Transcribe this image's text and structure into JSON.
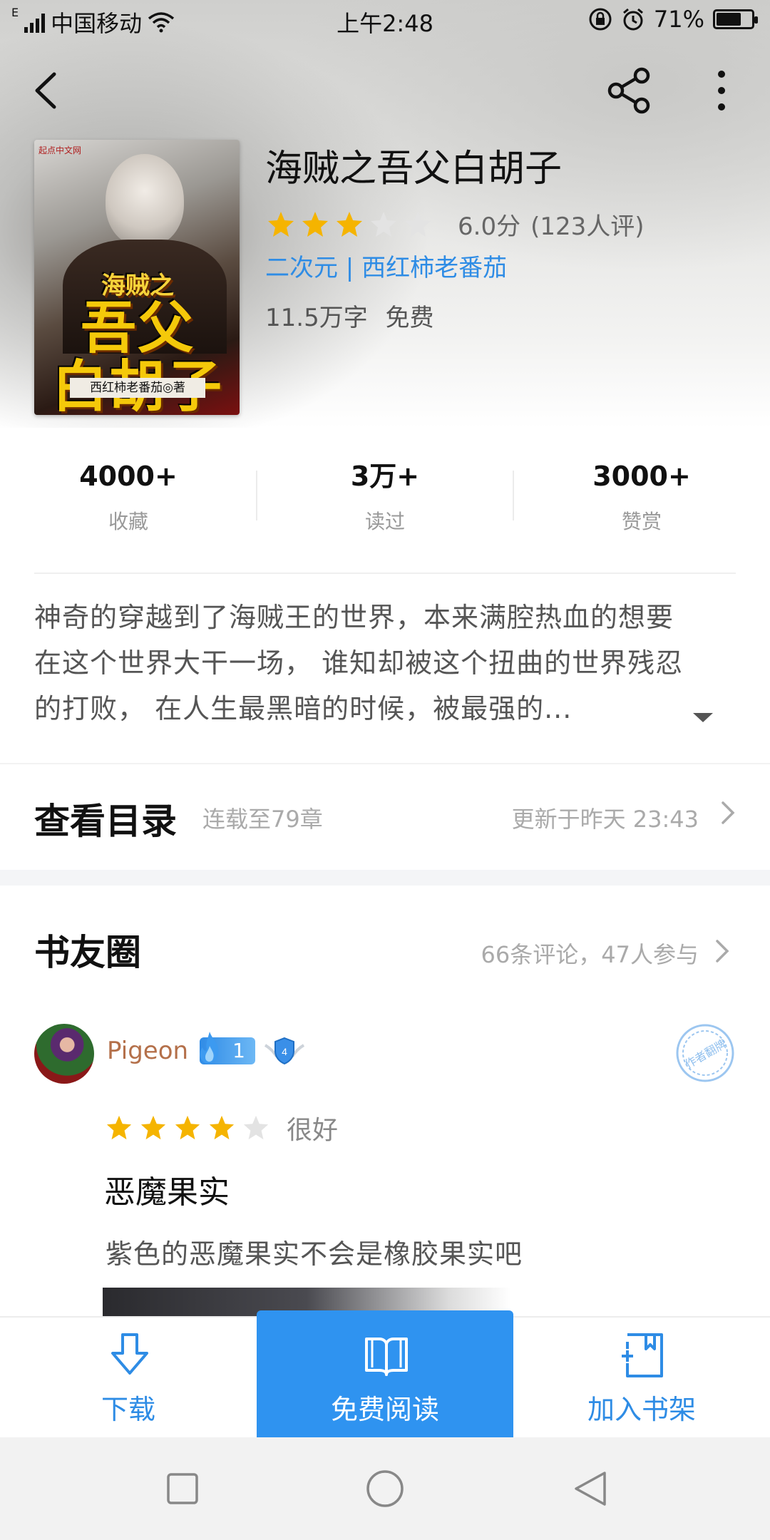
{
  "status_bar": {
    "carrier": "中国移动",
    "time": "上午2:48",
    "battery": "71%",
    "battery_level": 0.71,
    "network_small": "E"
  },
  "book": {
    "title": "海贼之吾父白胡子",
    "rating_stars": 3,
    "rating_max": 5,
    "score": "6.0分",
    "rating_count": "(123人评)",
    "tags": "二次元 | 西红柿老番茄",
    "word_count": "11.5万字",
    "price": "免费",
    "cover": {
      "publisher_mark": "起点中文网",
      "small_title": "海贼之",
      "big_title_line1": "吾父",
      "big_title_line2": "白胡子",
      "author_strip": "西红柿老番茄◎著"
    }
  },
  "stats": [
    {
      "value": "4000+",
      "label": "收藏"
    },
    {
      "value": "3万+",
      "label": "读过"
    },
    {
      "value": "3000+",
      "label": "赞赏"
    }
  ],
  "description": {
    "line1": "神奇的穿越到了海贼王的世界，本来满腔热血的想要",
    "line2": "在这个世界大干一场， 谁知却被这个扭曲的世界残忍",
    "line3": "的打败， 在人生最黑暗的时候，被最强的..."
  },
  "catalog": {
    "title": "查看目录",
    "progress": "连载至79章",
    "updated": "更新于昨天 23:43"
  },
  "circle": {
    "title": "书友圈",
    "summary": "66条评论，47人参与"
  },
  "review": {
    "username": "Pigeon",
    "fan_level": "1",
    "vip_level": "4",
    "stamp_text": "作者翻牌",
    "stars": 4,
    "rating_word": "很好",
    "title": "恶魔果实",
    "body": "紫色的恶魔果实不会是橡胶果实吧"
  },
  "actions": {
    "download": "下载",
    "read": "免费阅读",
    "add_shelf": "加入书架"
  },
  "colors": {
    "accent": "#2f93f0",
    "link": "#2e8ce5",
    "star": "#f5b400",
    "star_empty": "#e3e3e3",
    "username": "#b4704a"
  }
}
